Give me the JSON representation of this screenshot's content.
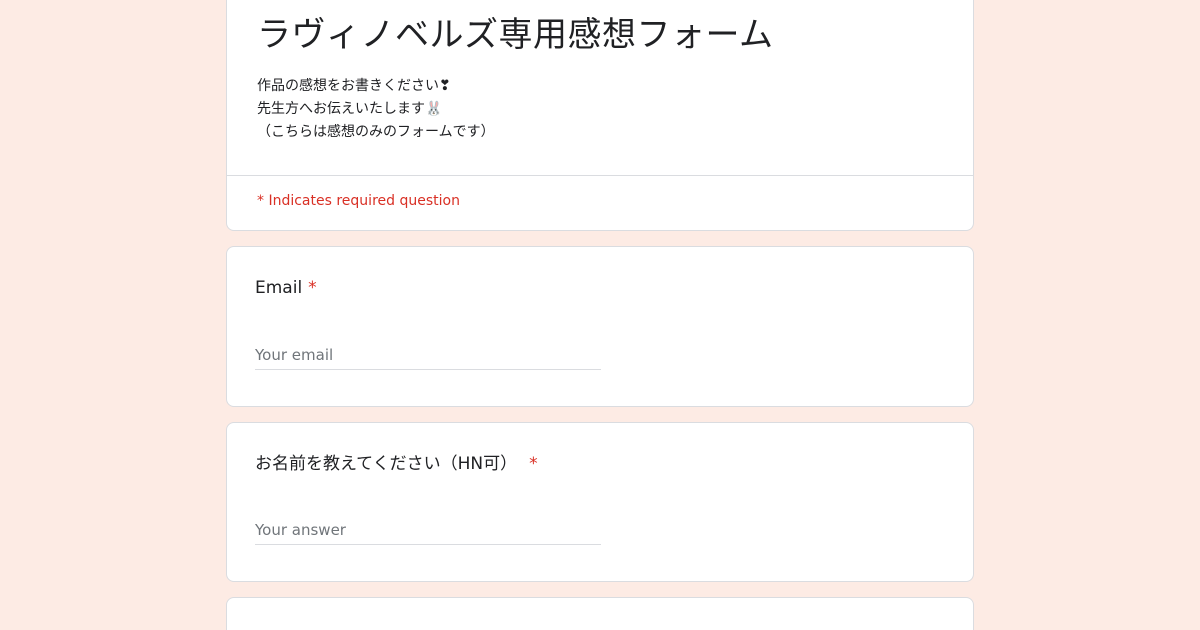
{
  "form": {
    "title": "ラヴィノベルズ専用感想フォーム",
    "description": [
      "作品の感想をお書きください❣",
      "先生方へお伝えいたします🐰",
      "（こちらは感想のみのフォームです）"
    ],
    "required_note": "* Indicates required question"
  },
  "questions": [
    {
      "title": "Email",
      "required_mark": "*",
      "placeholder": "Your email"
    },
    {
      "title": "お名前を教えてください（HN可）",
      "required_mark": "*",
      "placeholder": "Your answer"
    }
  ],
  "colors": {
    "page_background": "#fdebe4",
    "card_background": "#ffffff",
    "required_red": "#d93025",
    "divider": "#dadce0"
  }
}
